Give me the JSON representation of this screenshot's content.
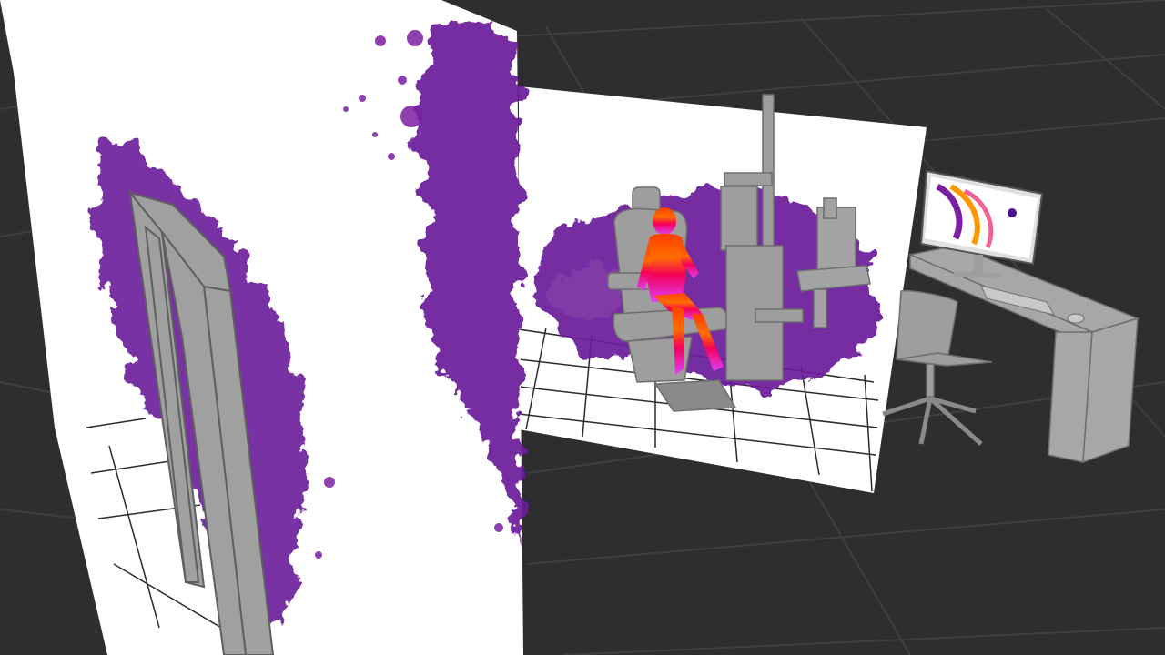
{
  "scene": {
    "description_visible_text": "",
    "colors": {
      "background": "#2e2e30",
      "floor_grid": "#3f3f42",
      "wall": "#ffffff",
      "paint_splash": "#6a1b9a",
      "paint_splash_light": "#8e44ad",
      "furniture": "#9a9a9a",
      "furniture_dark": "#6e6e6e",
      "heatmap_hot": "#ff3d00",
      "heatmap_warm": "#ff9100",
      "heatmap_cool": "#e91e63"
    },
    "objects": [
      "left-wall",
      "door",
      "back-wall",
      "exam-chair",
      "person-heatmap",
      "slit-lamp-stand",
      "instrument-table",
      "desk",
      "monitor",
      "keyboard",
      "mouse",
      "office-chair"
    ]
  },
  "monitor": {
    "caption": ""
  }
}
